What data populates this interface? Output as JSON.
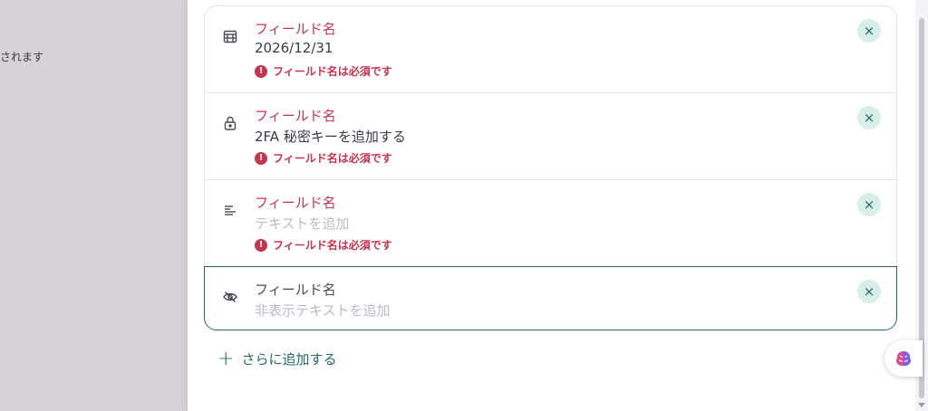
{
  "background": {
    "left_text": "されます"
  },
  "fields": [
    {
      "icon": "calendar-icon",
      "name": "フィールド名",
      "value": "2026/12/31",
      "placeholder": false,
      "error": "フィールド名は必須です"
    },
    {
      "icon": "lock-icon",
      "name": "フィールド名",
      "value": "2FA 秘密キーを追加する",
      "placeholder": false,
      "error": "フィールド名は必須です"
    },
    {
      "icon": "text-icon",
      "name": "フィールド名",
      "value": "テキストを追加",
      "placeholder": true,
      "error": "フィールド名は必須です"
    },
    {
      "icon": "eye-off-icon",
      "name": "フィールド名",
      "value": "非表示テキストを追加",
      "placeholder": true,
      "error": ""
    }
  ],
  "remove_symbol": "×",
  "add_more": {
    "label": "さらに追加する",
    "icon": "plus-icon"
  },
  "colors": {
    "accent": "#1f6b66",
    "error": "#c8334f",
    "chip_bg": "#d9eee9"
  }
}
